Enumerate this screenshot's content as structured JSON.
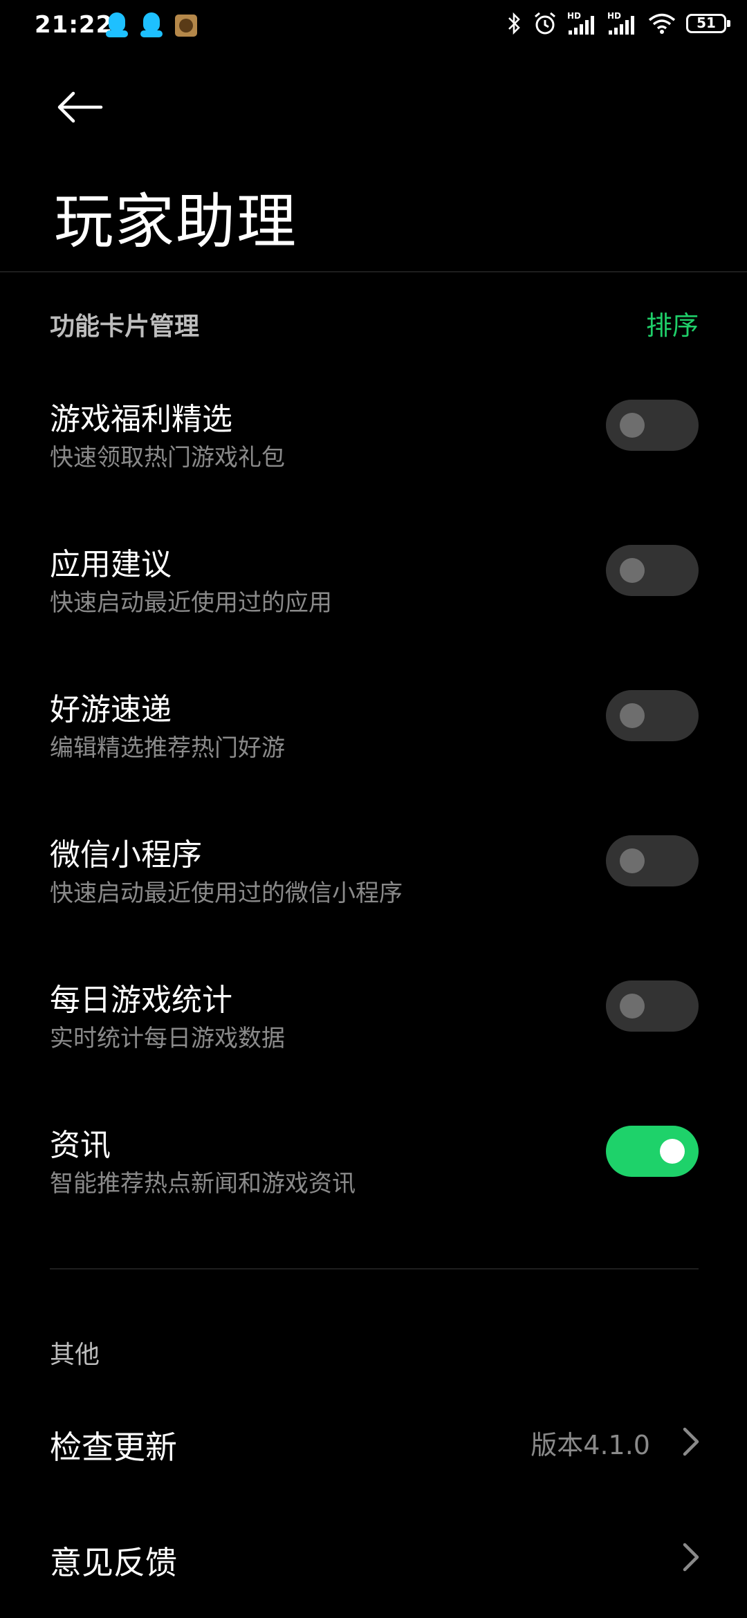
{
  "status_bar": {
    "time": "21:22",
    "left_icons": [
      "qq-icon",
      "qq-icon",
      "game-notification-icon"
    ],
    "right_icons": [
      "bluetooth-icon",
      "alarm-icon",
      "hd-signal-icon",
      "hd-signal-icon",
      "wifi-icon",
      "battery-icon"
    ],
    "hd_label": "HD",
    "battery": "51"
  },
  "header": {
    "back_icon": "back-arrow-icon",
    "title": "玩家助理"
  },
  "cards_section": {
    "title": "功能卡片管理",
    "sort_label": "排序",
    "accent_color": "#1fcf69",
    "items": [
      {
        "label": "游戏福利精选",
        "desc": "快速领取热门游戏礼包",
        "enabled": false
      },
      {
        "label": "应用建议",
        "desc": "快速启动最近使用过的应用",
        "enabled": false
      },
      {
        "label": "好游速递",
        "desc": "编辑精选推荐热门好游",
        "enabled": false
      },
      {
        "label": "微信小程序",
        "desc": "快速启动最近使用过的微信小程序",
        "enabled": false
      },
      {
        "label": "每日游戏统计",
        "desc": "实时统计每日游戏数据",
        "enabled": false
      },
      {
        "label": "资讯",
        "desc": "智能推荐热点新闻和游戏资讯",
        "enabled": true
      }
    ]
  },
  "other_section": {
    "title": "其他",
    "items": [
      {
        "label": "检查更新",
        "value": "版本4.1.0",
        "icon": "chevron-right-icon"
      },
      {
        "label": "意见反馈",
        "value": "",
        "icon": "chevron-right-icon"
      }
    ]
  }
}
